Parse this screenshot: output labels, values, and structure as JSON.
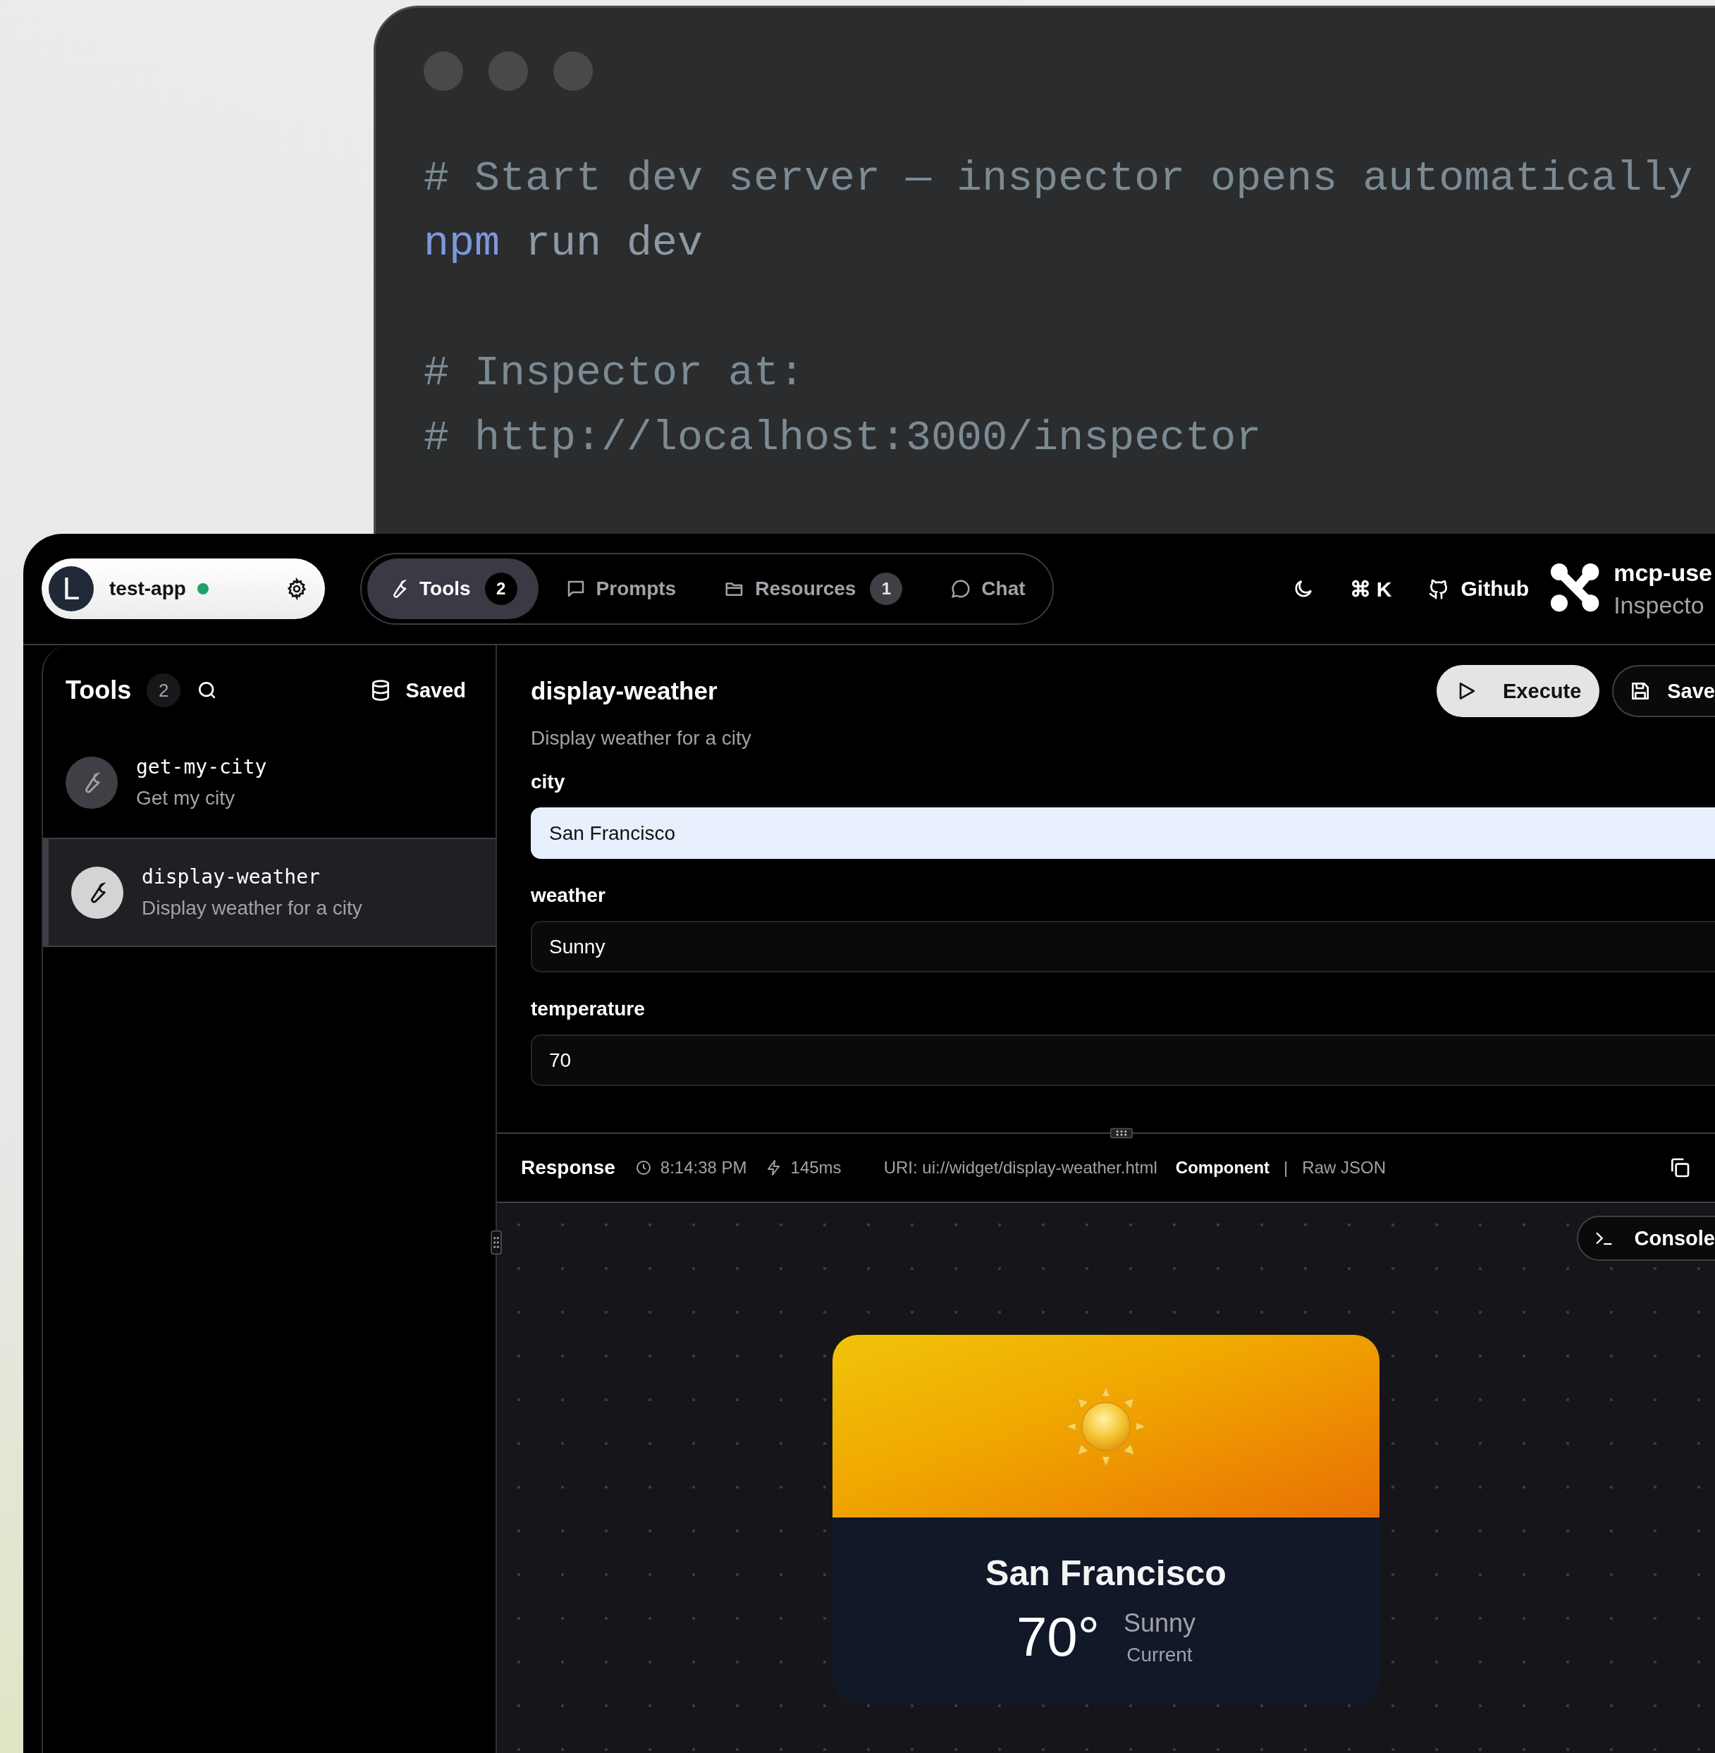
{
  "terminal": {
    "lines": [
      {
        "kind": "comment",
        "text": "# Start dev server — inspector opens automatically"
      },
      {
        "kind": "command",
        "command": "npm",
        "args": "run dev"
      },
      {
        "kind": "blank"
      },
      {
        "kind": "comment",
        "text": "# Inspector at:"
      },
      {
        "kind": "comment",
        "text": "# http://localhost:3000/inspector"
      }
    ]
  },
  "header": {
    "server": {
      "avatar_letter": "L",
      "name": "test-app",
      "connected": true
    },
    "tabs": [
      {
        "label": "Tools",
        "badge": "2",
        "selected": true
      },
      {
        "label": "Prompts",
        "selected": false
      },
      {
        "label": "Resources",
        "badge": "1",
        "selected": false
      },
      {
        "label": "Chat",
        "selected": false
      }
    ],
    "shortcut": "⌘ K",
    "github": "Github",
    "brand": {
      "name": "mcp-use",
      "subtitle": "Inspecto"
    }
  },
  "sidebar": {
    "title": "Tools",
    "count": "2",
    "saved": "Saved",
    "items": [
      {
        "name": "get-my-city",
        "description": "Get my city",
        "selected": false
      },
      {
        "name": "display-weather",
        "description": "Display weather for a city",
        "selected": true
      }
    ]
  },
  "tool": {
    "title": "display-weather",
    "description": "Display weather for a city",
    "execute": "Execute",
    "save": "Save",
    "fields": [
      {
        "label": "city",
        "value": "San Francisco",
        "focused": true
      },
      {
        "label": "weather",
        "value": "Sunny",
        "focused": false
      },
      {
        "label": "temperature",
        "value": "70",
        "focused": false
      }
    ]
  },
  "response": {
    "label": "Response",
    "time": "8:14:38 PM",
    "duration": "145ms",
    "uri": "URI: ui://widget/display-weather.html",
    "separator": "|",
    "views": [
      {
        "label": "Component",
        "selected": true
      },
      {
        "label": "Raw JSON",
        "selected": false
      }
    ],
    "console": "Console",
    "weather_card": {
      "city": "San Francisco",
      "temperature": "70°",
      "condition": "Sunny",
      "caption": "Current"
    }
  }
}
